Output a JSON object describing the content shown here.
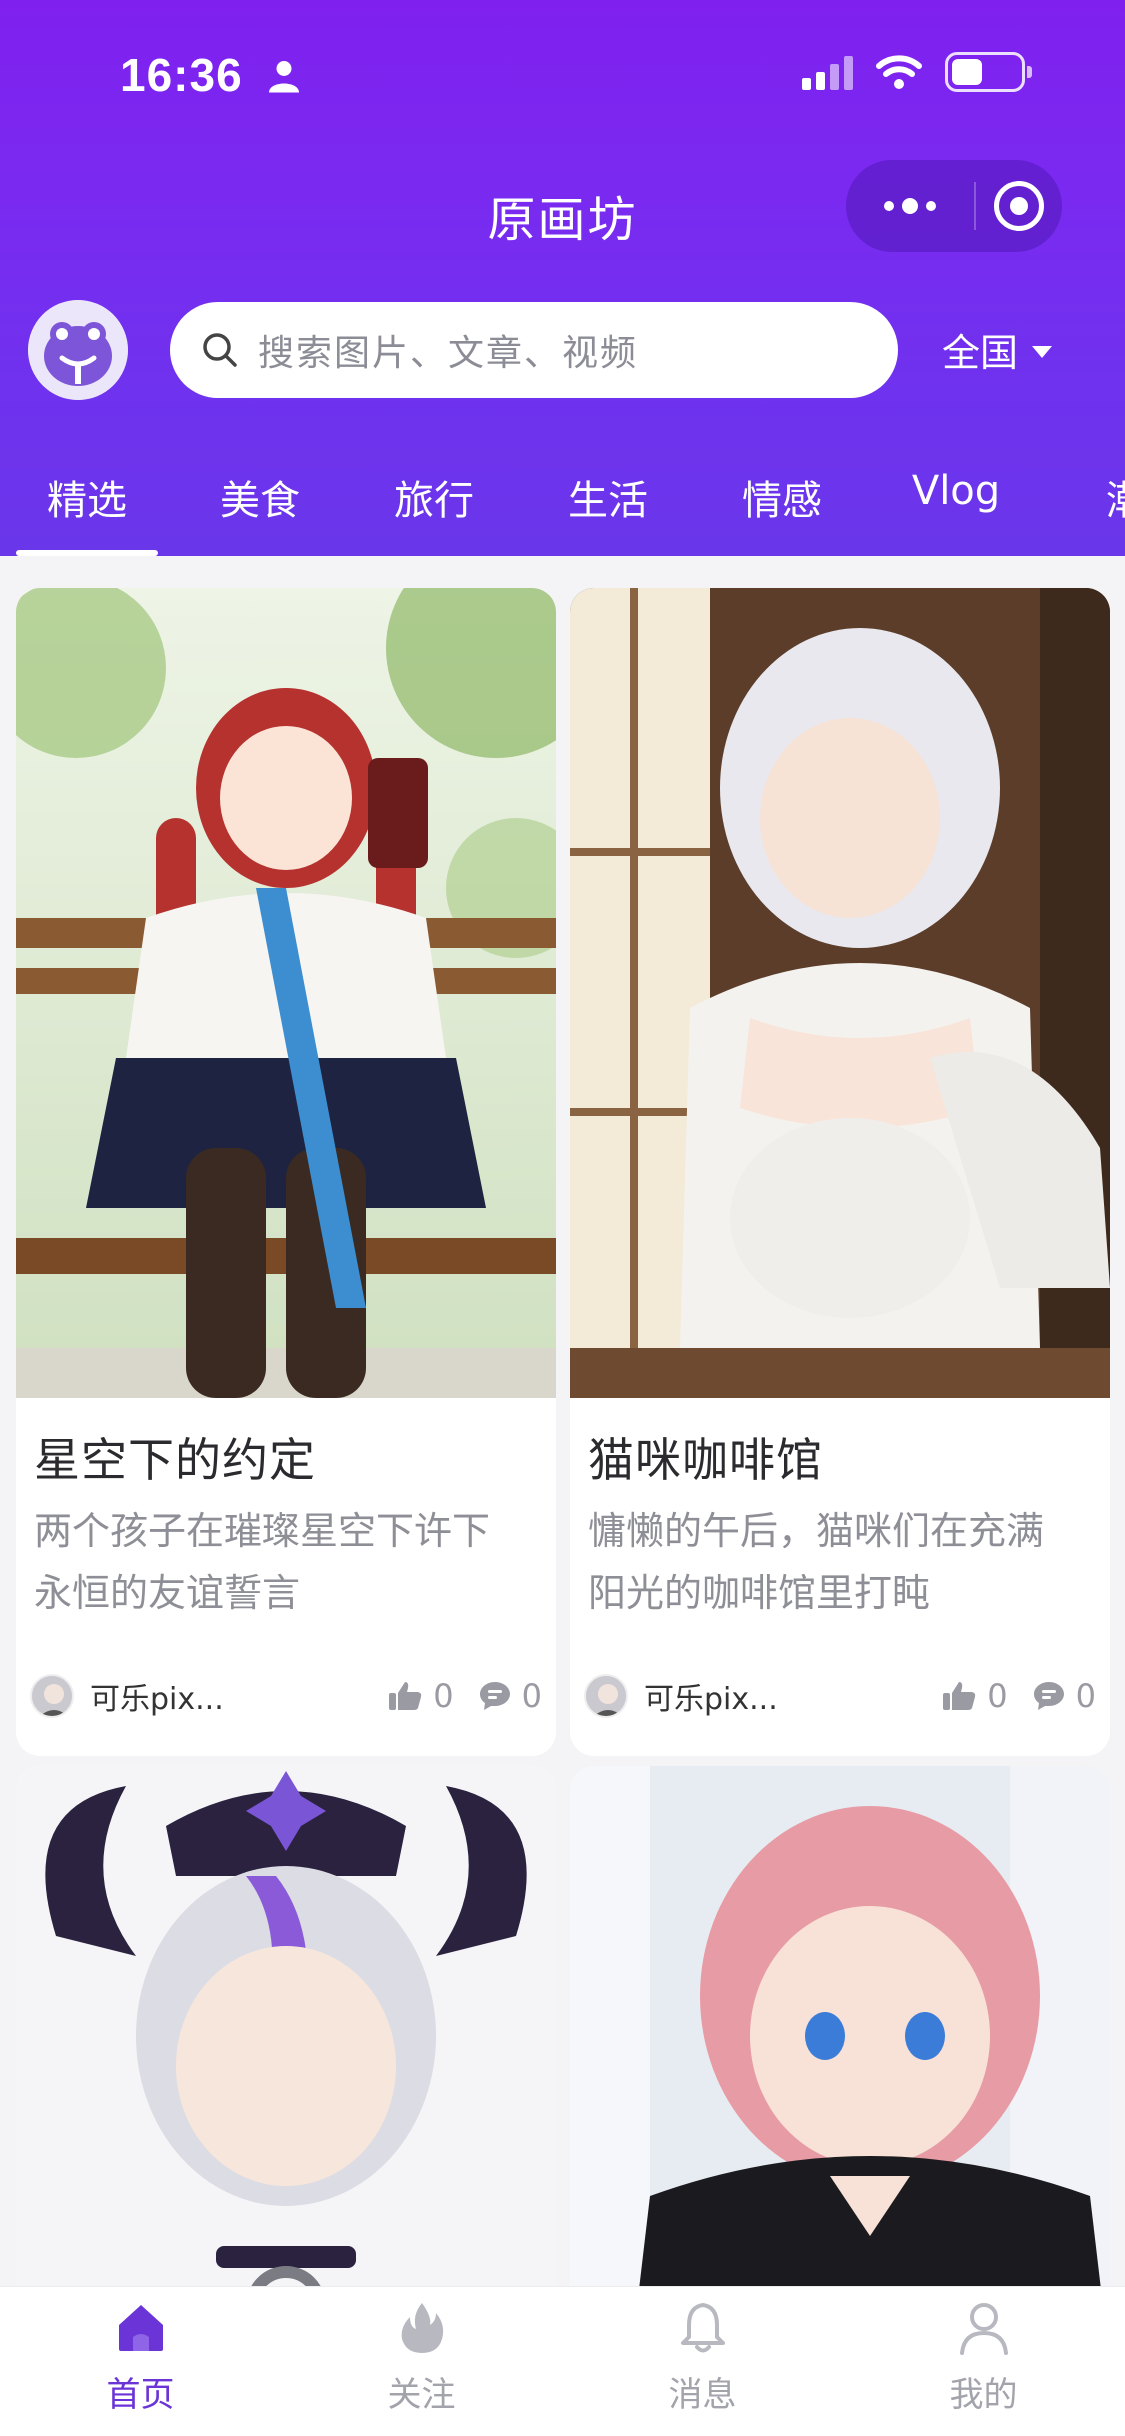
{
  "status_bar": {
    "time": "16:36"
  },
  "header": {
    "title": "原画坊",
    "search_placeholder": "搜索图片、文章、视频",
    "region": "全国"
  },
  "tabs": [
    "精选",
    "美食",
    "旅行",
    "生活",
    "情感",
    "Vlog",
    "潮"
  ],
  "active_tab": "精选",
  "cards": [
    {
      "title": "星空下的约定",
      "desc_line1": "两个孩子在璀璨星空下许下",
      "desc_line2": "永恒的友谊誓言",
      "author": "可乐pix...",
      "likes": "0",
      "comments": "0"
    },
    {
      "title": "猫咪咖啡馆",
      "desc_line1": "慵懒的午后，猫咪们在充满",
      "desc_line2": "阳光的咖啡馆里打盹",
      "author": "可乐pix...",
      "likes": "0",
      "comments": "0"
    }
  ],
  "tabbar": [
    {
      "label": "首页",
      "icon": "home-icon"
    },
    {
      "label": "关注",
      "icon": "flame-icon"
    },
    {
      "label": "消息",
      "icon": "bell-icon"
    },
    {
      "label": "我的",
      "icon": "user-icon"
    }
  ],
  "colors": {
    "brand": "#7a2af0",
    "tab_active": "#6a34d6",
    "tab_inactive": "#a3a3ab"
  }
}
